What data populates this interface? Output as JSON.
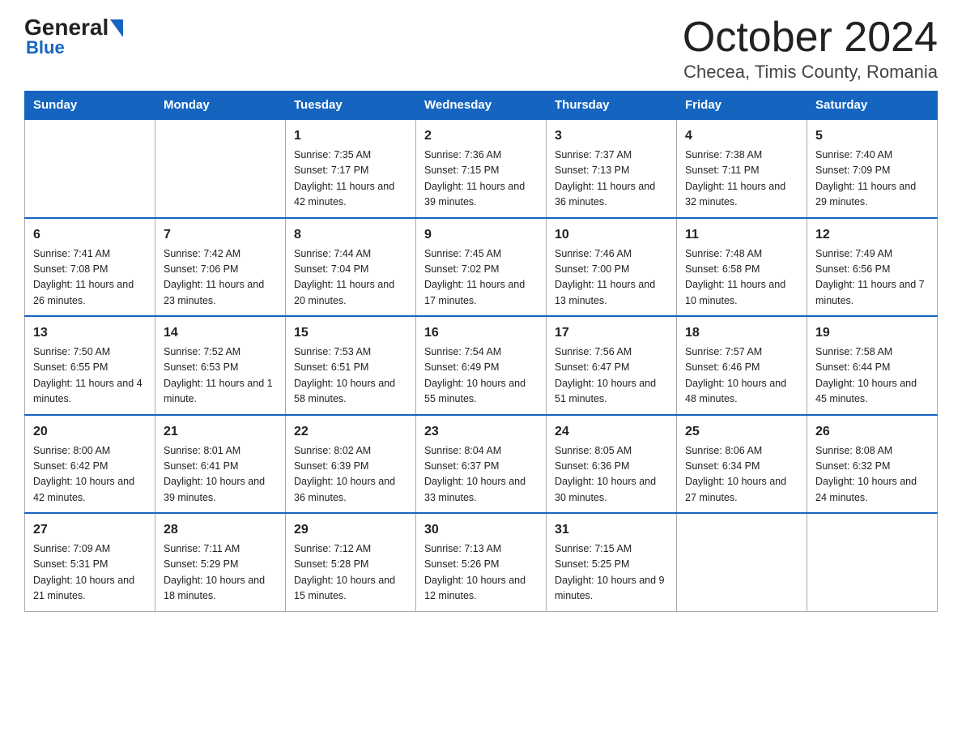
{
  "logo": {
    "line1_black": "General",
    "line1_blue": "Blue",
    "line2": "Blue"
  },
  "header": {
    "month_title": "October 2024",
    "location": "Checea, Timis County, Romania"
  },
  "days_of_week": [
    "Sunday",
    "Monday",
    "Tuesday",
    "Wednesday",
    "Thursday",
    "Friday",
    "Saturday"
  ],
  "weeks": [
    {
      "days": [
        {
          "number": "",
          "info": ""
        },
        {
          "number": "",
          "info": ""
        },
        {
          "number": "1",
          "info": "Sunrise: 7:35 AM\nSunset: 7:17 PM\nDaylight: 11 hours\nand 42 minutes."
        },
        {
          "number": "2",
          "info": "Sunrise: 7:36 AM\nSunset: 7:15 PM\nDaylight: 11 hours\nand 39 minutes."
        },
        {
          "number": "3",
          "info": "Sunrise: 7:37 AM\nSunset: 7:13 PM\nDaylight: 11 hours\nand 36 minutes."
        },
        {
          "number": "4",
          "info": "Sunrise: 7:38 AM\nSunset: 7:11 PM\nDaylight: 11 hours\nand 32 minutes."
        },
        {
          "number": "5",
          "info": "Sunrise: 7:40 AM\nSunset: 7:09 PM\nDaylight: 11 hours\nand 29 minutes."
        }
      ]
    },
    {
      "days": [
        {
          "number": "6",
          "info": "Sunrise: 7:41 AM\nSunset: 7:08 PM\nDaylight: 11 hours\nand 26 minutes."
        },
        {
          "number": "7",
          "info": "Sunrise: 7:42 AM\nSunset: 7:06 PM\nDaylight: 11 hours\nand 23 minutes."
        },
        {
          "number": "8",
          "info": "Sunrise: 7:44 AM\nSunset: 7:04 PM\nDaylight: 11 hours\nand 20 minutes."
        },
        {
          "number": "9",
          "info": "Sunrise: 7:45 AM\nSunset: 7:02 PM\nDaylight: 11 hours\nand 17 minutes."
        },
        {
          "number": "10",
          "info": "Sunrise: 7:46 AM\nSunset: 7:00 PM\nDaylight: 11 hours\nand 13 minutes."
        },
        {
          "number": "11",
          "info": "Sunrise: 7:48 AM\nSunset: 6:58 PM\nDaylight: 11 hours\nand 10 minutes."
        },
        {
          "number": "12",
          "info": "Sunrise: 7:49 AM\nSunset: 6:56 PM\nDaylight: 11 hours\nand 7 minutes."
        }
      ]
    },
    {
      "days": [
        {
          "number": "13",
          "info": "Sunrise: 7:50 AM\nSunset: 6:55 PM\nDaylight: 11 hours\nand 4 minutes."
        },
        {
          "number": "14",
          "info": "Sunrise: 7:52 AM\nSunset: 6:53 PM\nDaylight: 11 hours\nand 1 minute."
        },
        {
          "number": "15",
          "info": "Sunrise: 7:53 AM\nSunset: 6:51 PM\nDaylight: 10 hours\nand 58 minutes."
        },
        {
          "number": "16",
          "info": "Sunrise: 7:54 AM\nSunset: 6:49 PM\nDaylight: 10 hours\nand 55 minutes."
        },
        {
          "number": "17",
          "info": "Sunrise: 7:56 AM\nSunset: 6:47 PM\nDaylight: 10 hours\nand 51 minutes."
        },
        {
          "number": "18",
          "info": "Sunrise: 7:57 AM\nSunset: 6:46 PM\nDaylight: 10 hours\nand 48 minutes."
        },
        {
          "number": "19",
          "info": "Sunrise: 7:58 AM\nSunset: 6:44 PM\nDaylight: 10 hours\nand 45 minutes."
        }
      ]
    },
    {
      "days": [
        {
          "number": "20",
          "info": "Sunrise: 8:00 AM\nSunset: 6:42 PM\nDaylight: 10 hours\nand 42 minutes."
        },
        {
          "number": "21",
          "info": "Sunrise: 8:01 AM\nSunset: 6:41 PM\nDaylight: 10 hours\nand 39 minutes."
        },
        {
          "number": "22",
          "info": "Sunrise: 8:02 AM\nSunset: 6:39 PM\nDaylight: 10 hours\nand 36 minutes."
        },
        {
          "number": "23",
          "info": "Sunrise: 8:04 AM\nSunset: 6:37 PM\nDaylight: 10 hours\nand 33 minutes."
        },
        {
          "number": "24",
          "info": "Sunrise: 8:05 AM\nSunset: 6:36 PM\nDaylight: 10 hours\nand 30 minutes."
        },
        {
          "number": "25",
          "info": "Sunrise: 8:06 AM\nSunset: 6:34 PM\nDaylight: 10 hours\nand 27 minutes."
        },
        {
          "number": "26",
          "info": "Sunrise: 8:08 AM\nSunset: 6:32 PM\nDaylight: 10 hours\nand 24 minutes."
        }
      ]
    },
    {
      "days": [
        {
          "number": "27",
          "info": "Sunrise: 7:09 AM\nSunset: 5:31 PM\nDaylight: 10 hours\nand 21 minutes."
        },
        {
          "number": "28",
          "info": "Sunrise: 7:11 AM\nSunset: 5:29 PM\nDaylight: 10 hours\nand 18 minutes."
        },
        {
          "number": "29",
          "info": "Sunrise: 7:12 AM\nSunset: 5:28 PM\nDaylight: 10 hours\nand 15 minutes."
        },
        {
          "number": "30",
          "info": "Sunrise: 7:13 AM\nSunset: 5:26 PM\nDaylight: 10 hours\nand 12 minutes."
        },
        {
          "number": "31",
          "info": "Sunrise: 7:15 AM\nSunset: 5:25 PM\nDaylight: 10 hours\nand 9 minutes."
        },
        {
          "number": "",
          "info": ""
        },
        {
          "number": "",
          "info": ""
        }
      ]
    }
  ]
}
